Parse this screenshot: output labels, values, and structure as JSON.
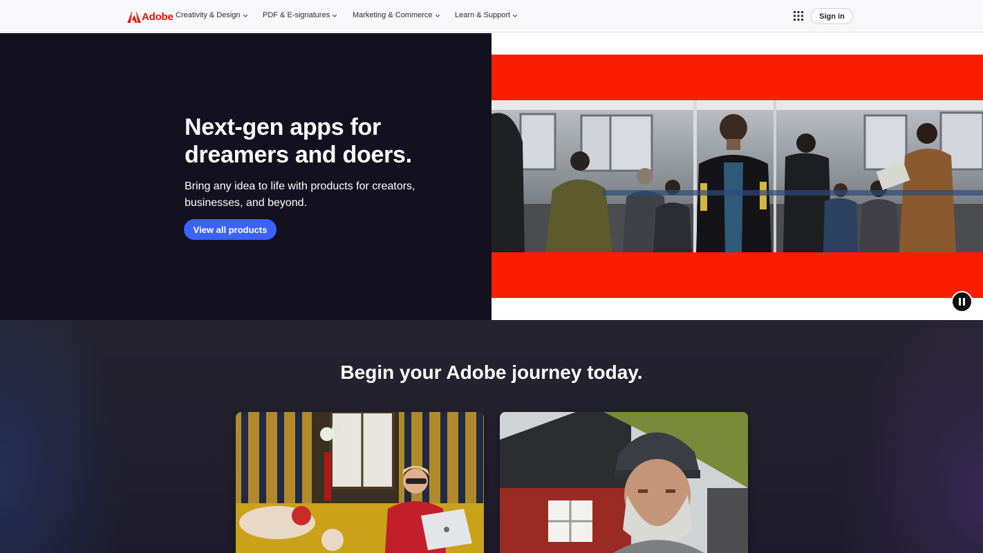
{
  "nav": {
    "logo_text": "Adobe",
    "menus": [
      {
        "label": "Creativity & Design"
      },
      {
        "label": "PDF & E-signatures"
      },
      {
        "label": "Marketing & Commerce"
      },
      {
        "label": "Learn & Support"
      }
    ],
    "apps_icon": "apps-grid-icon",
    "sign_in": "Sign in"
  },
  "hero": {
    "title": "Next-gen apps for dreamers and doers.",
    "subtitle": "Bring any idea to life with products for creators, businesses, and beyond.",
    "cta": "View all products",
    "media_icon": "pause-icon"
  },
  "journey": {
    "title": "Begin your Adobe journey today."
  },
  "colors": {
    "brand_red": "#eb1000",
    "hero_bg": "#13111f",
    "cta_blue": "#3b63fb",
    "video_red": "#fa1e00"
  }
}
